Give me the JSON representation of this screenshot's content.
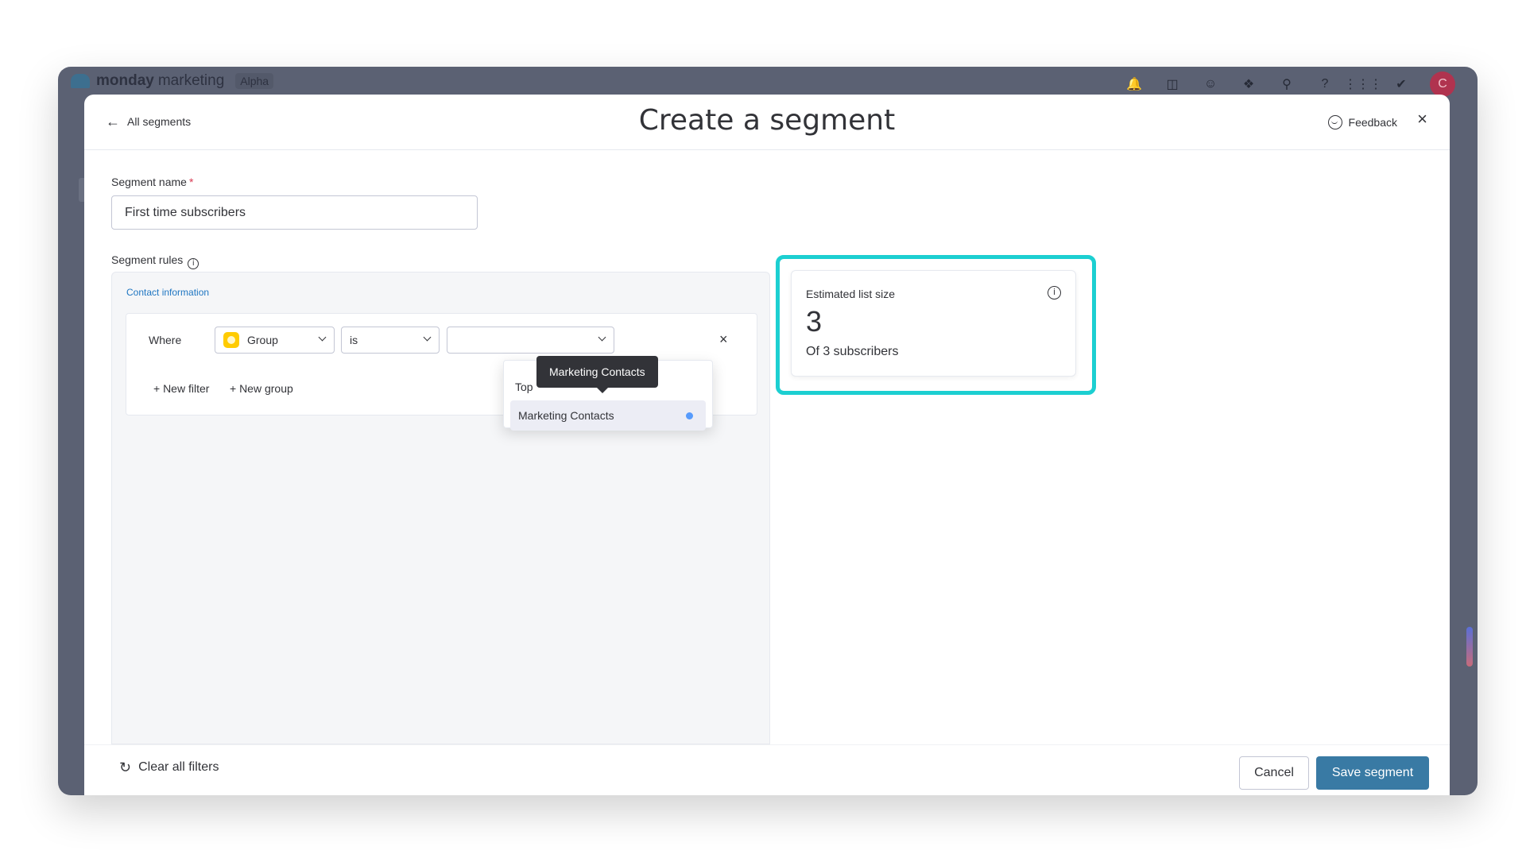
{
  "app": {
    "brand_bold": "monday",
    "brand_light": "marketing",
    "badge": "Alpha",
    "avatar_initial": "C",
    "topbar_icons": [
      "bell-icon",
      "inbox-icon",
      "invite-user-icon",
      "integrations-icon",
      "search-icon",
      "help-icon",
      "apps-grid-icon",
      "monday-logo-icon"
    ]
  },
  "modal": {
    "back_label": "All segments",
    "title": "Create a segment",
    "feedback_label": "Feedback",
    "close_glyph": "×"
  },
  "segment": {
    "name_label": "Segment name",
    "required_mark": "*",
    "name_value": "First time subscribers",
    "rules_label": "Segment rules",
    "info_glyph": "i"
  },
  "rules": {
    "section_heading": "Contact information",
    "where_label": "Where",
    "column_value": "Group",
    "operator_value": "is",
    "value_value": "",
    "remove_glyph": "×",
    "new_filter_label": "+ New filter",
    "new_group_label": "+ New group"
  },
  "menu": {
    "section_label": "Top",
    "item_label": "Marketing Contacts",
    "tooltip": "Marketing Contacts"
  },
  "estimate": {
    "label": "Estimated list size",
    "value": "3",
    "subtext": "Of 3 subscribers"
  },
  "footer": {
    "clear_label": "Clear all filters",
    "cancel_label": "Cancel",
    "save_label": "Save segment"
  },
  "colors": {
    "primary": "#397aa4",
    "highlight": "#1ccfd1",
    "group_color": "#ffcb00",
    "required": "#d83a52",
    "link": "#1f76c2"
  }
}
